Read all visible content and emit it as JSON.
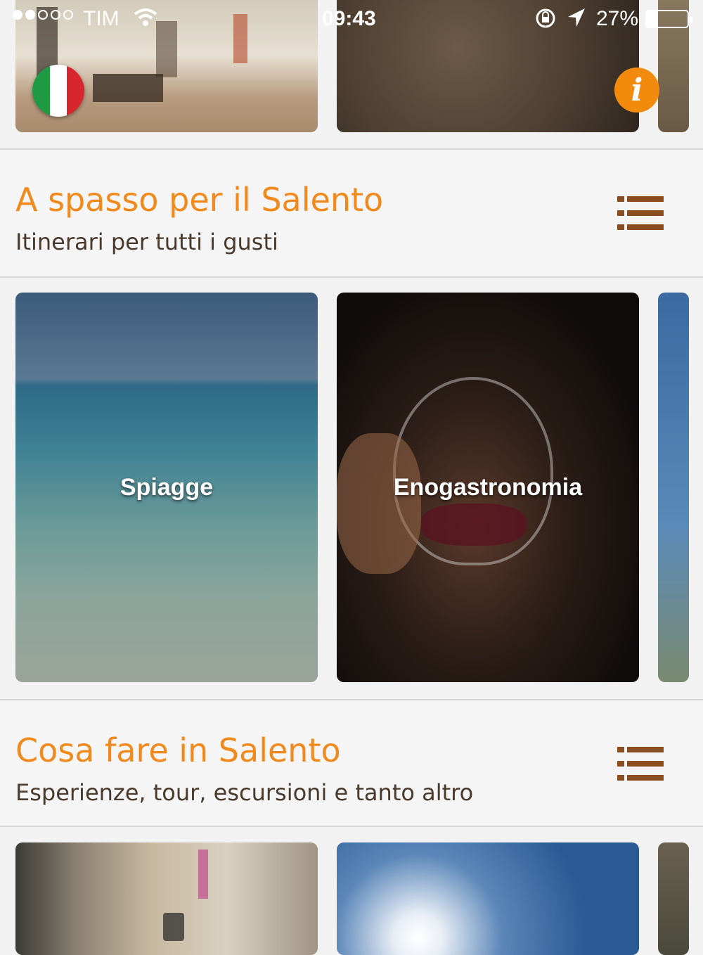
{
  "status_bar": {
    "carrier": "TIM",
    "time": "09:43",
    "battery_percent": "27%",
    "battery_level": 0.27,
    "signal_bars_filled": 2,
    "signal_bars_total": 5
  },
  "top_row": {
    "language_flag": "italy-flag-icon",
    "info_icon": "i"
  },
  "sections": [
    {
      "title": "A spasso per il Salento",
      "subtitle": "Itinerari per tutti i gusti",
      "cards": [
        {
          "label": "Spiagge"
        },
        {
          "label": "Enogastronomia"
        }
      ]
    },
    {
      "title": "Cosa fare in Salento",
      "subtitle": "Esperienze, tour, escursioni e tanto altro",
      "cards": [
        {
          "label": ""
        },
        {
          "label": ""
        }
      ]
    }
  ],
  "colors": {
    "accent": "#f08a1d",
    "list_icon": "#8a4d1f",
    "subtitle": "#4a3a2c"
  }
}
